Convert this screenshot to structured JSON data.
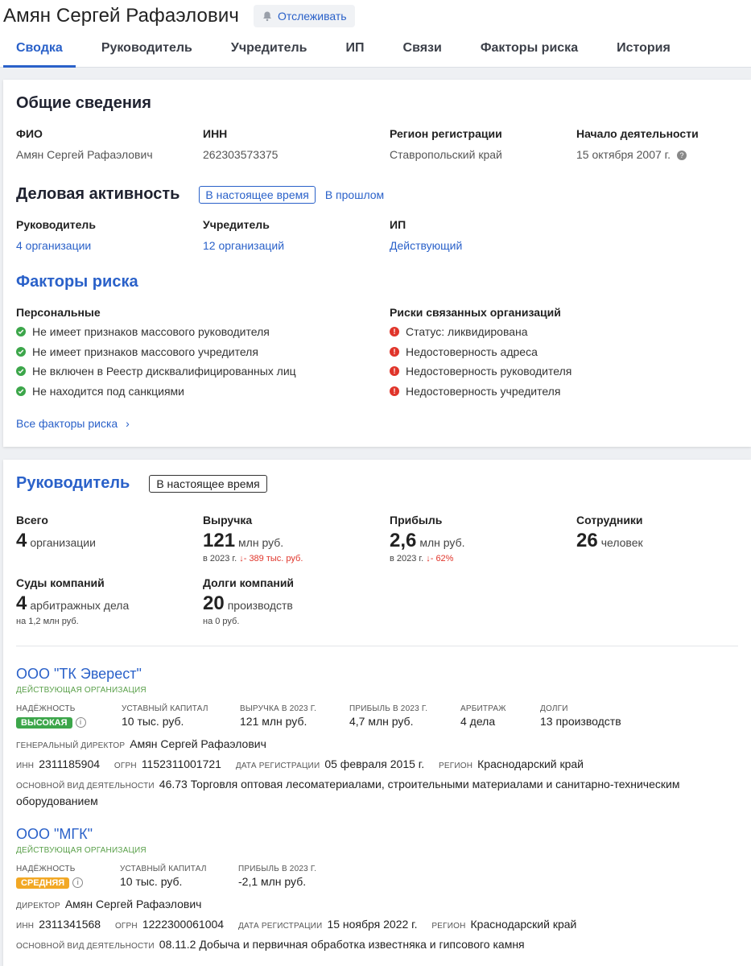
{
  "header": {
    "title": "Амян Сергей Рафаэлович",
    "track_label": "Отслеживать",
    "tabs": [
      "Сводка",
      "Руководитель",
      "Учредитель",
      "ИП",
      "Связи",
      "Факторы риска",
      "История"
    ]
  },
  "general": {
    "title": "Общие сведения",
    "fields": [
      {
        "label": "ФИО",
        "value": "Амян Сергей Рафаэлович"
      },
      {
        "label": "ИНН",
        "value": "262303573375"
      },
      {
        "label": "Регион регистрации",
        "value": "Ставропольский край"
      },
      {
        "label": "Начало деятельности",
        "value": "15 октября 2007 г."
      }
    ]
  },
  "activity": {
    "title": "Деловая активность",
    "now_label": "В настоящее время",
    "past_label": "В прошлом",
    "fields": [
      {
        "label": "Руководитель",
        "value": "4 организации"
      },
      {
        "label": "Учредитель",
        "value": "12 организаций"
      },
      {
        "label": "ИП",
        "value": "Действующий"
      }
    ]
  },
  "risks": {
    "title": "Факторы риска",
    "personal_title": "Персональные",
    "personal": [
      "Не имеет признаков массового руководителя",
      "Не имеет признаков массового учредителя",
      "Не включен в Реестр дисквалифицированных лиц",
      "Не находится под санкциями"
    ],
    "related_title": "Риски связанных организаций",
    "related": [
      "Статус: ликвидирована",
      "Недостоверность адреса",
      "Недостоверность руководителя",
      "Недостоверность учредителя"
    ],
    "all_link": "Все факторы риска"
  },
  "manager": {
    "title": "Руководитель",
    "filter": "В настоящее время",
    "stats": {
      "total_label": "Всего",
      "total_value": "4",
      "total_unit": "организации",
      "revenue_label": "Выручка",
      "revenue_value": "121",
      "revenue_unit": "млн руб.",
      "revenue_year": "в 2023 г.",
      "revenue_delta": "- 389 тыс. руб.",
      "profit_label": "Прибыль",
      "profit_value": "2,6",
      "profit_unit": "млн руб.",
      "profit_year": "в 2023 г.",
      "profit_delta": "- 62%",
      "staff_label": "Сотрудники",
      "staff_value": "26",
      "staff_unit": "человек",
      "courts_label": "Суды компаний",
      "courts_value": "4",
      "courts_unit": "арбитражных дела",
      "courts_sub": "на 1,2 млн руб.",
      "debts_label": "Долги компаний",
      "debts_value": "20",
      "debts_unit": "производств",
      "debts_sub": "на 0 руб."
    },
    "orgs": [
      {
        "name": "ООО \"ТК Эверест\"",
        "status": "Действующая организация",
        "metrics": [
          {
            "label": "Надёжность",
            "value": "Высокая"
          },
          {
            "label": "Уставный капитал",
            "value": "10 тыс. руб."
          },
          {
            "label": "Выручка в 2023 г.",
            "value": "121 млн руб."
          },
          {
            "label": "Прибыль в 2023 г.",
            "value": "4,7 млн руб."
          },
          {
            "label": "Арбитраж",
            "value": "4 дела"
          },
          {
            "label": "Долги",
            "value": "13 производств"
          }
        ],
        "director_label": "Генеральный директор",
        "director": "Амян Сергей Рафаэлович",
        "inn_label": "ИНН",
        "inn": "2311185904",
        "ogrn_label": "ОГРН",
        "ogrn": "1152311001721",
        "reg_label": "Дата регистрации",
        "reg": "05 февраля 2015 г.",
        "region_label": "Регион",
        "region": "Краснодарский край",
        "activity_label": "Основной вид деятельности",
        "activity": "46.73 Торговля оптовая лесоматериалами, строительными материалами и санитарно-техническим оборудованием"
      },
      {
        "name": "ООО \"МГК\"",
        "status": "Действующая организация",
        "metrics": [
          {
            "label": "Надёжность",
            "value": "Средняя"
          },
          {
            "label": "Уставный капитал",
            "value": "10 тыс. руб."
          },
          {
            "label": "Прибыль в 2023 г.",
            "value": "-2,1 млн руб."
          }
        ],
        "director_label": "Директор",
        "director": "Амян Сергей Рафаэлович",
        "inn_label": "ИНН",
        "inn": "2311341568",
        "ogrn_label": "ОГРН",
        "ogrn": "1222300061004",
        "reg_label": "Дата регистрации",
        "reg": "15 ноября 2022 г.",
        "region_label": "Регион",
        "region": "Краснодарский край",
        "activity_label": "Основной вид деятельности",
        "activity": "08.11.2 Добыча и первичная обработка известняка и гипсового камня"
      }
    ]
  },
  "colors": {
    "accent": "#2a61c9",
    "ok": "#3ca64a",
    "bad": "#e0352b",
    "medium": "#f2a825"
  }
}
